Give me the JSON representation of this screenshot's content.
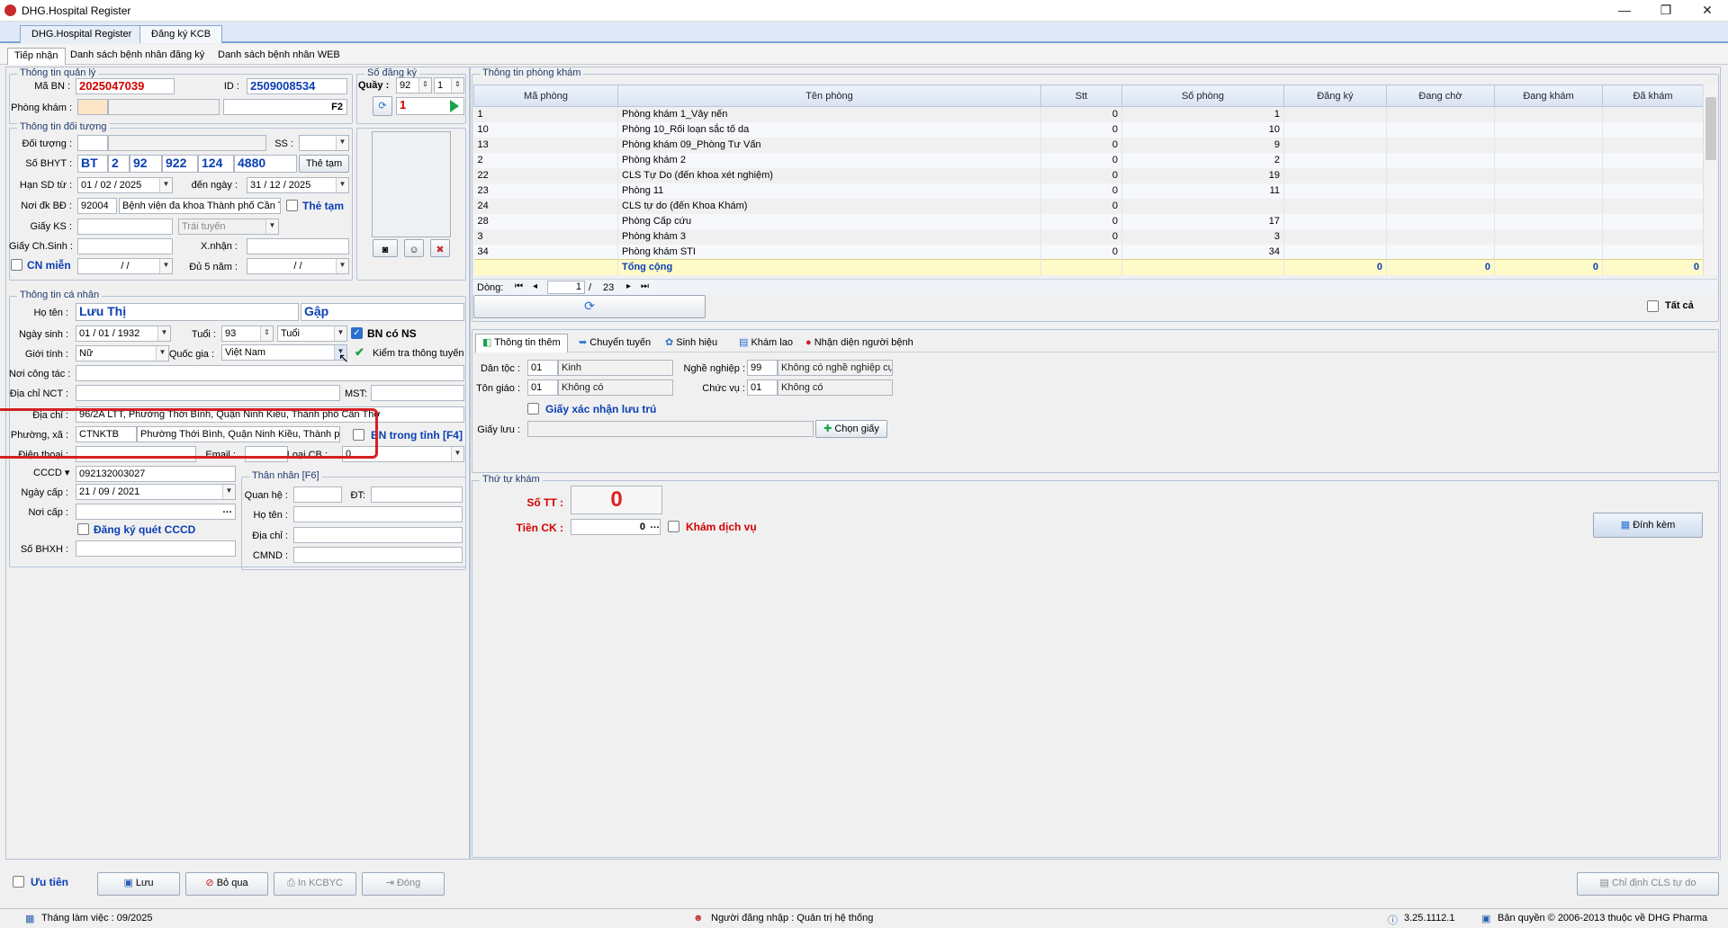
{
  "window": {
    "title": "DHG.Hospital Register"
  },
  "doc_tabs": [
    "DHG.Hospital Register",
    "Đăng ký KCB"
  ],
  "sub_tabs": [
    "Tiếp nhận",
    "Danh sách bệnh nhân đăng ký",
    "Danh sách bệnh nhân WEB"
  ],
  "quanly": {
    "title": "Thông tin quản lý",
    "ma_bn_label": "Mã BN :",
    "ma_bn": "2025047039",
    "id_label": "ID :",
    "id": "2509008534",
    "phong_kham_label": "Phòng khám :",
    "f2": "F2"
  },
  "sodangky": {
    "title": "Số đăng ký",
    "quay_label": "Quầy :",
    "quay": "92",
    "quay2": "1",
    "so": "1"
  },
  "doituong": {
    "title": "Thông tin đối tượng",
    "doi_tuong_label": "Đối tượng :",
    "ss_label": "SS :",
    "so_bhyt_label": "Số BHYT :",
    "bhyt": [
      "BT",
      "2",
      "92",
      "922",
      "124",
      "4880"
    ],
    "the_tam_btn": "Thẻ tạm",
    "han_sd_label": "Hạn SD từ :",
    "han_tu": "01 / 02 / 2025",
    "den_ngay_label": "đến ngày :",
    "han_den": "31 / 12 / 2025",
    "noi_dk_label": "Nơi đk BĐ :",
    "noi_dk_code": "92004",
    "noi_dk_name": "Bệnh viện đa khoa Thành phố Cần Thơ",
    "the_tam_chk": "Thẻ tạm",
    "giay_ks_label": "Giấy KS :",
    "trai_tuyen": "Trái tuyến",
    "giay_cs_label": "Giấy Ch.Sinh :",
    "xnhan_label": "X.nhận :",
    "cn_mien": "CN miễn",
    "date_blank": "/      /",
    "du5nam_label": "Đủ 5 năm :"
  },
  "canhan": {
    "title": "Thông tin cá nhân",
    "ho_ten_label": "Họ tên :",
    "ho": "Lưu Thị",
    "ten": "Gập",
    "ngay_sinh_label": "Ngày sinh :",
    "ngay_sinh": "01 / 01 / 1932",
    "tuoi_label": "Tuổi :",
    "tuoi": "93",
    "tuoi_unit": "Tuổi",
    "bn_co_ns": "BN có NS",
    "gioi_tinh_label": "Giới tính :",
    "gioi_tinh": "Nữ",
    "quoc_gia_label": "Quốc gia :",
    "quoc_gia": "Việt Nam",
    "kiem_tra": "Kiểm tra thông tuyến",
    "noi_cong_tac_label": "Nơi công tác :",
    "dia_chi_nct_label": "Địa chỉ  NCT :",
    "mst_label": "MST:",
    "dia_chi_label": "Địa chỉ :",
    "dia_chi": "96/2A LTT, Phường Thới Bình, Quận Ninh Kiều, Thành phố Cần Thơ",
    "phuong_label": "Phường, xã :",
    "phuong_code": "CTNKTB",
    "phuong_name": "Phường Thới Bình, Quận Ninh Kiều, Thành phố Cần Thơ",
    "bn_trong_tinh": "BN trong tỉnh [F4]",
    "dien_thoai_label": "Điện thoại :",
    "email_label": "Email :",
    "loai_cb_label": "Loại CB :",
    "loai_cb": "0",
    "cccd_label": "CCCD",
    "cccd": "092132003027",
    "ngay_cap_label": "Ngày cấp :",
    "ngay_cap": "21 / 09 / 2021",
    "noi_cap_label": "Nơi cấp :",
    "dk_quet": "Đăng ký quét CCCD",
    "so_bhxh_label": "Số BHXH :"
  },
  "thannhan": {
    "title": "Thân nhân [F6]",
    "quan_he": "Quan hệ :",
    "dt": "ĐT:",
    "ho_ten": "Họ tên :",
    "dia_chi": "Địa chỉ :",
    "cmnd": "CMND :"
  },
  "phongkham": {
    "title": "Thông tin phòng khám",
    "headers": [
      "Mã phòng",
      "Tên phòng",
      "Stt",
      "Số phòng",
      "Đăng ký",
      "Đang chờ",
      "Đang khám",
      "Đã khám"
    ],
    "rows": [
      [
        "1",
        "Phòng khám 1_Vảy nến",
        "0",
        "1",
        "",
        "",
        "",
        ""
      ],
      [
        "10",
        "Phòng 10_Rối loạn sắc tố da",
        "0",
        "10",
        "",
        "",
        "",
        ""
      ],
      [
        "13",
        "Phòng khám 09_Phòng Tư Vấn",
        "0",
        "9",
        "",
        "",
        "",
        ""
      ],
      [
        "2",
        "Phòng khám 2",
        "0",
        "2",
        "",
        "",
        "",
        ""
      ],
      [
        "22",
        "CLS Tự Do (đến khoa xét nghiệm)",
        "0",
        "19",
        "",
        "",
        "",
        ""
      ],
      [
        "23",
        "Phòng 11",
        "0",
        "11",
        "",
        "",
        "",
        ""
      ],
      [
        "24",
        "CLS tự do (đến Khoa Khám)",
        "0",
        "",
        "",
        "",
        "",
        ""
      ],
      [
        "28",
        "Phòng Cấp cứu",
        "0",
        "17",
        "",
        "",
        "",
        ""
      ],
      [
        "3",
        "Phòng khám 3",
        "0",
        "3",
        "",
        "",
        "",
        ""
      ],
      [
        "34",
        "Phòng khám STI",
        "0",
        "34",
        "",
        "",
        "",
        ""
      ]
    ],
    "total": [
      "",
      "Tổng cộng",
      "",
      "",
      "0",
      "0",
      "0",
      "0"
    ],
    "dong_label": "Dòng:",
    "page": "1",
    "pages": "23",
    "tat_ca": "Tất cả"
  },
  "extra_tabs": [
    "Thông tin thêm",
    "Chuyển tuyến",
    "Sinh hiệu",
    "Khám lao",
    "Nhận diện người bệnh"
  ],
  "thongtinthem": {
    "dan_toc_label": "Dân tộc :",
    "dan_toc_code": "01",
    "dan_toc": "Kinh",
    "nghe_label": "Nghề nghiệp :",
    "nghe_code": "99",
    "nghe": "Không có nghề nghiệp cụ thể",
    "ton_giao_label": "Tôn giáo :",
    "ton_giao_code": "01",
    "ton_giao": "Không có",
    "chuc_vu_label": "Chức vụ :",
    "chuc_vu_code": "01",
    "chuc_vu": "Không có",
    "giay_xn": "Giấy xác nhận lưu trú",
    "giay_luu_label": "Giấy lưu :",
    "chon_giay": "Chọn giấy"
  },
  "thutu": {
    "title": "Thứ tự khám",
    "so_tt_label": "Số TT :",
    "so_tt": "0",
    "tien_ck_label": "Tiền CK :",
    "tien_ck": "0",
    "kham_dv": "Khám dịch vụ",
    "dinh_kem": "Đính kèm"
  },
  "bottom": {
    "uu_tien": "Ưu tiên",
    "luu": "Lưu",
    "bo_qua": "Bỏ qua",
    "in": "In KCBYC",
    "dong": "Đóng",
    "chi_dinh": "Chỉ định CLS tự do"
  },
  "status": {
    "thang": "Tháng làm việc : 09/2025",
    "user": "Người đăng nhập : Quản trị hệ thống",
    "version": "3.25.1112.1",
    "copyright": "Bản quyền © 2006-2013 thuộc về DHG Pharma"
  },
  "colors": {
    "accent": "#0b3fb4",
    "red": "#d40000",
    "highlight": "#d42020"
  }
}
